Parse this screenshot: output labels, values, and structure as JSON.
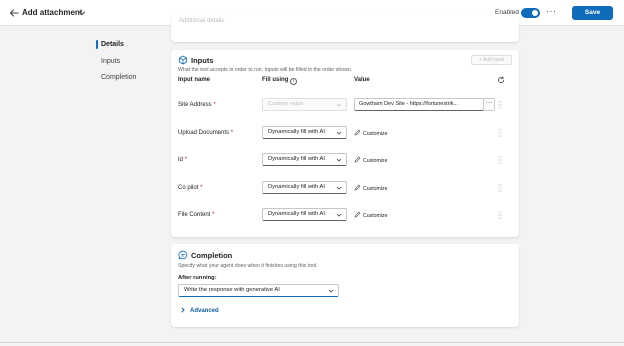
{
  "header": {
    "title": "Add attachment",
    "enabled_label": "Enabled",
    "more_label": "···",
    "save_label": "Save"
  },
  "nav": {
    "items": [
      {
        "label": "Details",
        "active": true
      },
      {
        "label": "Inputs",
        "active": false
      },
      {
        "label": "Completion",
        "active": false
      }
    ]
  },
  "prev_card": {
    "text": "Additional details"
  },
  "inputs": {
    "title": "Inputs",
    "description": "What the tool accepts in order to run. Inputs will be filled in the order shown.",
    "add_input_label": "+ Add input",
    "col_input_name": "Input name",
    "col_fill_using": "Fill using",
    "info_glyph": "i",
    "col_value": "Value",
    "customize_label": "Customize",
    "rows": [
      {
        "name": "Site Address",
        "required": "*",
        "fill": "Custom value",
        "value": "Gowtham Dev Site - https://fortunestrik...",
        "value_more": "···"
      },
      {
        "name": "Upload Documents",
        "required": "*",
        "fill": "Dynamically fill with AI"
      },
      {
        "name": "Id",
        "required": "*",
        "fill": "Dynamically fill with AI"
      },
      {
        "name": "Co pilot",
        "required": "*",
        "fill": "Dynamically fill with AI"
      },
      {
        "name": "File Content",
        "required": "*",
        "fill": "Dynamically fill with AI"
      }
    ]
  },
  "completion": {
    "title": "Completion",
    "description": "Specify what your agent does when it finishes using this tool.",
    "after_running_label": "After running:",
    "after_running_value": "Write the response with generative AI",
    "advanced_label": "Advanced"
  },
  "colors": {
    "accent": "#0f6cbd",
    "required": "#c50f1f",
    "link": "#115ea3"
  }
}
